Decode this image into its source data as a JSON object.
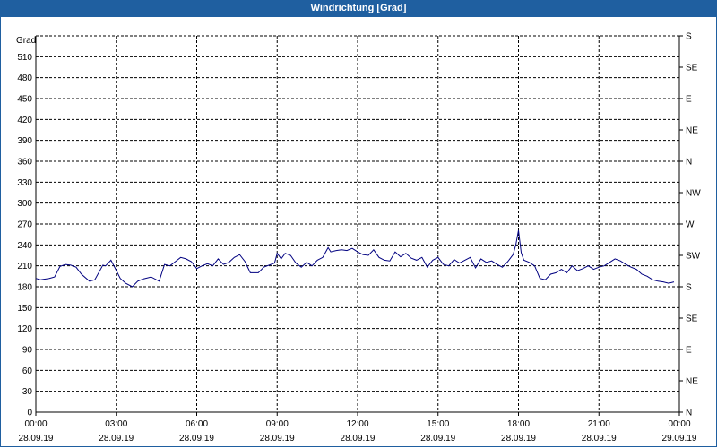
{
  "window": {
    "title": "Windrichtung [Grad]"
  },
  "chart_data": {
    "type": "line",
    "title": "Windrichtung [Grad]",
    "ylabel": "Grad",
    "ylim": [
      0,
      540
    ],
    "y_ticks": [
      0,
      30,
      60,
      90,
      120,
      150,
      180,
      210,
      240,
      270,
      300,
      330,
      360,
      390,
      420,
      450,
      480,
      510
    ],
    "x_range_hours": [
      0,
      24
    ],
    "x_ticks": [
      {
        "hour": 0,
        "time": "00:00",
        "date": "28.09.19"
      },
      {
        "hour": 3,
        "time": "03:00",
        "date": "28.09.19"
      },
      {
        "hour": 6,
        "time": "06:00",
        "date": "28.09.19"
      },
      {
        "hour": 9,
        "time": "09:00",
        "date": "28.09.19"
      },
      {
        "hour": 12,
        "time": "12:00",
        "date": "28.09.19"
      },
      {
        "hour": 15,
        "time": "15:00",
        "date": "28.09.19"
      },
      {
        "hour": 18,
        "time": "18:00",
        "date": "28.09.19"
      },
      {
        "hour": 21,
        "time": "21:00",
        "date": "28.09.19"
      },
      {
        "hour": 24,
        "time": "00:00",
        "date": "29.09.19"
      }
    ],
    "right_axis": [
      {
        "deg": 0,
        "label": "N"
      },
      {
        "deg": 45,
        "label": "NE"
      },
      {
        "deg": 90,
        "label": "E"
      },
      {
        "deg": 135,
        "label": "SE"
      },
      {
        "deg": 180,
        "label": "S"
      },
      {
        "deg": 225,
        "label": "SW"
      },
      {
        "deg": 270,
        "label": "W"
      },
      {
        "deg": 315,
        "label": "NW"
      },
      {
        "deg": 360,
        "label": "N"
      },
      {
        "deg": 405,
        "label": "NE"
      },
      {
        "deg": 450,
        "label": "E"
      },
      {
        "deg": 495,
        "label": "SE"
      },
      {
        "deg": 540,
        "label": "S"
      }
    ],
    "grid": true,
    "series": [
      {
        "color": "#000080",
        "x": [
          0,
          0.17,
          0.5,
          0.7,
          0.9,
          1.1,
          1.3,
          1.5,
          1.7,
          2.0,
          2.2,
          2.5,
          2.6,
          2.8,
          2.95,
          3.15,
          3.35,
          3.6,
          3.8,
          4.0,
          4.3,
          4.6,
          4.8,
          5.0,
          5.2,
          5.4,
          5.6,
          5.8,
          6.0,
          6.2,
          6.4,
          6.6,
          6.8,
          7.0,
          7.2,
          7.4,
          7.6,
          7.8,
          8.0,
          8.3,
          8.5,
          8.7,
          8.9,
          9.0,
          9.15,
          9.3,
          9.5,
          9.7,
          9.9,
          10.1,
          10.3,
          10.5,
          10.7,
          10.9,
          11.0,
          11.2,
          11.4,
          11.6,
          11.8,
          12.0,
          12.2,
          12.4,
          12.6,
          12.8,
          13.0,
          13.2,
          13.4,
          13.6,
          13.8,
          14.0,
          14.2,
          14.4,
          14.6,
          14.8,
          15.0,
          15.2,
          15.4,
          15.6,
          15.8,
          16.0,
          16.2,
          16.4,
          16.6,
          16.8,
          17.0,
          17.2,
          17.4,
          17.6,
          17.8,
          17.9,
          18.0,
          18.1,
          18.2,
          18.4,
          18.6,
          18.8,
          19.0,
          19.2,
          19.4,
          19.6,
          19.8,
          20.0,
          20.2,
          20.4,
          20.6,
          20.8,
          21.0,
          21.2,
          21.4,
          21.6,
          21.8,
          22.0,
          22.2,
          22.4,
          22.6,
          22.8,
          23.0,
          23.2,
          23.4,
          23.6,
          23.8
        ],
        "values": [
          192,
          190,
          192,
          194,
          209,
          212,
          211,
          208,
          198,
          188,
          190,
          211,
          210,
          218,
          207,
          192,
          185,
          180,
          188,
          191,
          194,
          188,
          212,
          210,
          216,
          222,
          220,
          216,
          206,
          210,
          213,
          210,
          220,
          212,
          215,
          222,
          226,
          216,
          200,
          200,
          208,
          211,
          214,
          228,
          220,
          228,
          225,
          214,
          208,
          215,
          210,
          218,
          222,
          236,
          230,
          232,
          233,
          232,
          235,
          230,
          226,
          225,
          233,
          222,
          218,
          217,
          230,
          223,
          228,
          221,
          218,
          222,
          208,
          218,
          222,
          212,
          210,
          219,
          214,
          218,
          222,
          207,
          220,
          215,
          217,
          212,
          208,
          216,
          226,
          240,
          261,
          229,
          218,
          215,
          210,
          192,
          190,
          198,
          200,
          205,
          200,
          210,
          203,
          206,
          210,
          205,
          208,
          210,
          215,
          220,
          217,
          212,
          208,
          205,
          198,
          195,
          190,
          188,
          187,
          185,
          187
        ]
      }
    ]
  }
}
